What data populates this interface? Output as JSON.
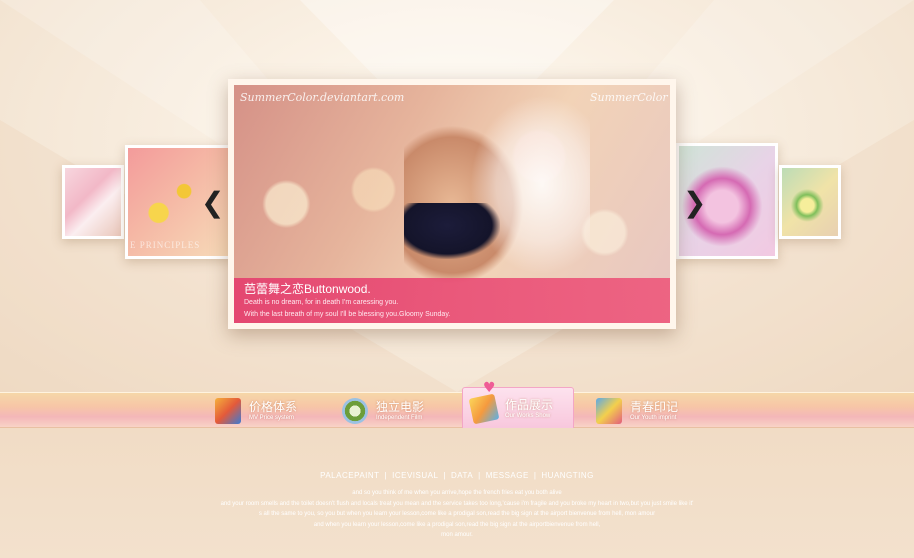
{
  "slider": {
    "watermark": "SummerColor.deviantart.com",
    "watermark_right": "SummerColor",
    "thumb_left_watermark": "E PRINCIPLES",
    "caption_title": "芭蕾舞之恋Buttonwood.",
    "caption_line1": "Death is no dream, for in death I'm caressing you.",
    "caption_line2": "With the last breath of my soul I'll be blessing you.Gloomy Sunday.",
    "prev_icon": "chevron-left-icon",
    "next_icon": "chevron-right-icon",
    "prev_glyph": "❮",
    "next_glyph": "❯"
  },
  "nav": {
    "items": [
      {
        "title": "价格体系",
        "sub": "MV Price system",
        "icon": "film-clapper-icon"
      },
      {
        "title": "独立电影",
        "sub": "Independent Film",
        "icon": "film-reel-icon"
      },
      {
        "title": "作品展示",
        "sub": "Our Works Show",
        "icon": "works-folder-icon"
      },
      {
        "title": "青春印记",
        "sub": "Our Youth imprint",
        "icon": "youth-imprint-icon"
      }
    ],
    "active_heart": "♥"
  },
  "footer": {
    "links": [
      "PALACEPAINT",
      "ICEVISUAL",
      "DATA",
      "MESSAGE",
      "HUANGTING"
    ],
    "separator": "|",
    "lines": [
      "and so you think of me when you arrive,hope the french fries eat you both alive",
      "and your room smells and the toilet doesn't flush and locals treat you mean and the service takes too long,'cause i'm fragile and you broke my heart in two,but you just smile like it'",
      "s all the same to you, so you but when you learn your lesson,come like a prodigal son,read the big sign at the airport bienvenue from hell, mon amour",
      "and when you learn your lesson,come like a prodigal son,read the big sign at the airportbienvenue from hell,",
      "mon amour."
    ]
  },
  "colors": {
    "caption_bg": "#e4406e",
    "nav_band": "#f7c6a7",
    "active_tab": "#f8c6dc"
  }
}
